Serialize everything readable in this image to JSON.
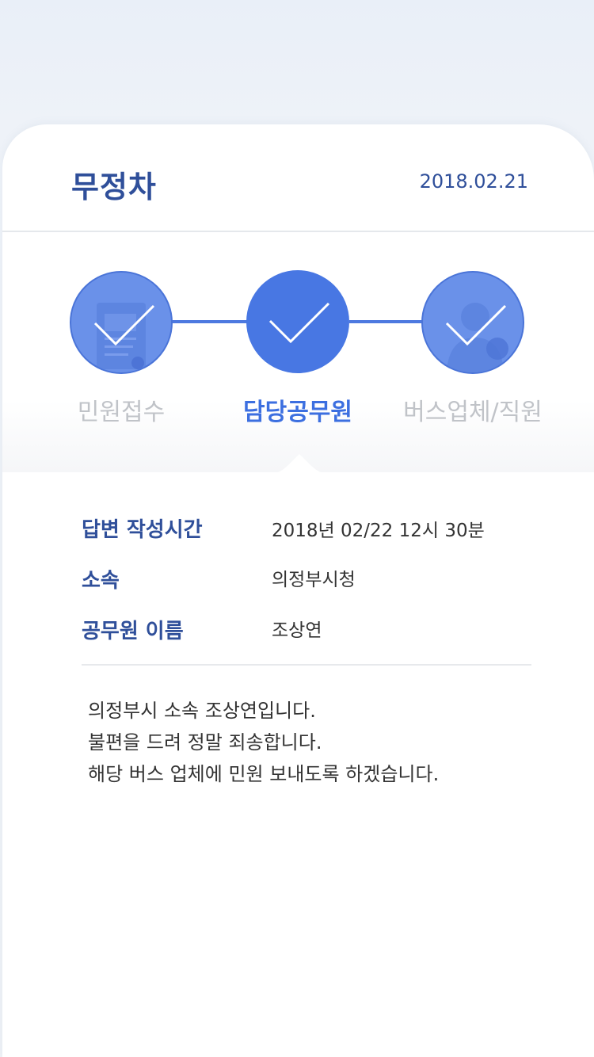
{
  "header": {
    "title": "무정차",
    "date": "2018.02.21"
  },
  "steps": [
    {
      "label": "민원접수",
      "state": "completed",
      "icon": "document-icon"
    },
    {
      "label": "담당공무원",
      "state": "current",
      "icon": "check-icon"
    },
    {
      "label": "버스업체/직원",
      "state": "completed",
      "icon": "person-icon"
    }
  ],
  "details": {
    "rows": [
      {
        "label": "답변 작성시간",
        "value": "2018년 02/22   12시 30분"
      },
      {
        "label": "소속",
        "value": "의정부시청"
      },
      {
        "label": "공무원 이름",
        "value": "조상연"
      }
    ],
    "message": [
      "의정부시 소속 조상연입니다.",
      "불편을 드려 정말 죄송합니다.",
      "해당 버스 업체에 민원 보내도록 하겠습니다."
    ]
  },
  "colors": {
    "brand": "#2f4f9a",
    "accent": "#4877e3",
    "inactive_label": "#c0c3c8",
    "background": "#eef1f6"
  }
}
